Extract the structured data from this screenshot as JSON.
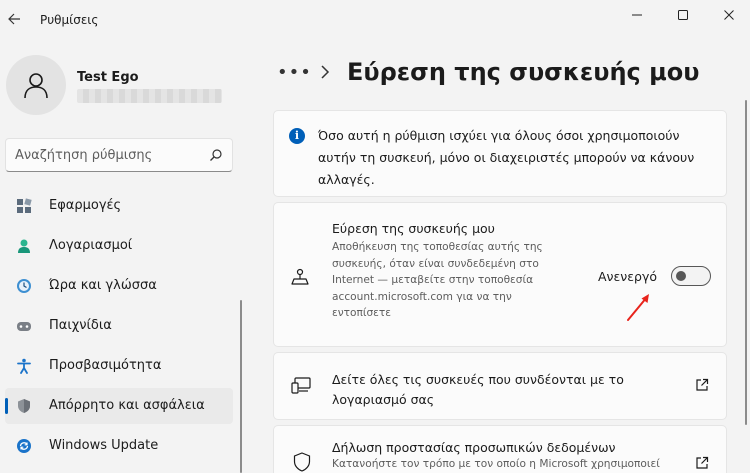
{
  "app": {
    "title": "Ρυθμίσεις"
  },
  "profile": {
    "name": "Test Ego"
  },
  "search": {
    "placeholder": "Αναζήτηση ρύθμισης"
  },
  "nav": {
    "items": [
      {
        "label": "Εφαρμογές",
        "icon": "apps-icon"
      },
      {
        "label": "Λογαριασμοί",
        "icon": "accounts-icon"
      },
      {
        "label": "Ώρα και γλώσσα",
        "icon": "time-language-icon"
      },
      {
        "label": "Παιχνίδια",
        "icon": "gaming-icon"
      },
      {
        "label": "Προσβασιμότητα",
        "icon": "accessibility-icon"
      },
      {
        "label": "Απόρρητο και ασφάλεια",
        "icon": "shield-icon",
        "active": true
      },
      {
        "label": "Windows Update",
        "icon": "windows-update-icon"
      }
    ]
  },
  "breadcrumb": {
    "more": "•••"
  },
  "page": {
    "title": "Εύρεση της συσκευής μου"
  },
  "info": {
    "text": "Όσο αυτή η ρύθμιση ισχύει για όλους όσοι χρησιμοποιούν αυτήν τη συσκευή, μόνο οι διαχειριστές μπορούν να κάνουν αλλαγές."
  },
  "find_device": {
    "title": "Εύρεση της συσκευής μου",
    "description": "Αποθήκευση της τοποθεσίας αυτής της συσκευής, όταν είναι συνδεδεμένη στο Internet — μεταβείτε στην τοποθεσία account.microsoft.com για να την εντοπίσετε",
    "toggle_state": "Ανενεργό",
    "toggle_on": false
  },
  "devices_link": {
    "text": "Δείτε όλες τις συσκευές που συνδέονται με το λογαριασμό σας"
  },
  "privacy": {
    "title": "Δήλωση προστασίας προσωπικών δεδομένων",
    "description": "Κατανοήστε τον τρόπο με τον οποίο η Microsoft χρησιμοποιεί"
  },
  "colors": {
    "accent": "#005fb8",
    "annotation_arrow": "#e8241c"
  }
}
